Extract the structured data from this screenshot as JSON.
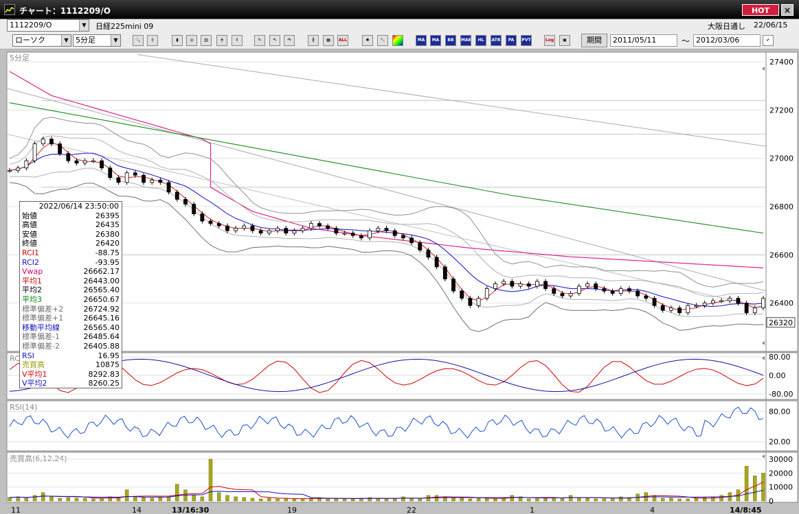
{
  "window": {
    "title": "チャート：1112209/O",
    "hot_label": "HOT",
    "close_label": "×"
  },
  "symbol": {
    "code": "1112209/O",
    "name": "日経225mini 09",
    "exchange": "大阪日通し",
    "date": "22/06/15"
  },
  "toolbar": {
    "chart_type": "ローソク",
    "interval": "5分足",
    "icons": [
      "zoom-icon",
      "crosshair-icon",
      "candle-icon",
      "search-chart-icon",
      "bar-chart-icon",
      "compare-icon",
      "info-icon",
      "pencil-icon",
      "cursor-icon",
      "redo-icon",
      "candle-compare-icon",
      "grid-icon",
      "all-label",
      "settings-icon",
      "paint-icon",
      "palette-icon",
      "ma-icon",
      "bb-icon",
      "mae-icon",
      "hl-icon",
      "atr-icon",
      "para-icon",
      "pvt-icon",
      "log-icon",
      "export-icon"
    ],
    "all_label": "ALL",
    "ma_label": "MA",
    "bb_label": "BB",
    "mae_label": "MAE",
    "hl_label": "HL",
    "atr_label": "ATR",
    "para_label": "PA RA",
    "pvt_label": "PVT",
    "log_label": "Log",
    "period_label": "期間",
    "date_from": "2011/05/11",
    "date_to": "2012/03/06",
    "tilde": "〜"
  },
  "panels": {
    "main_label": "5分足",
    "rci_label": "RC",
    "rsi_label": "RSI(14)",
    "volume_label": "売買高(6,12,24)",
    "current_price": "26320"
  },
  "price_axis": [
    "27400",
    "27200",
    "27000",
    "26800",
    "26600",
    "26400"
  ],
  "rci_axis": [
    "80.00",
    "0.00",
    "-80.00"
  ],
  "rsi_axis": [
    "80.00",
    "20.00"
  ],
  "volume_axis": [
    "30000",
    "20000",
    "10000",
    "0"
  ],
  "time_axis": [
    "11",
    "14",
    "13/16:30",
    "19",
    "22",
    "1",
    "4",
    "14/8:45"
  ],
  "info": {
    "datetime": "2022/06/14 23:50:00",
    "rows": [
      {
        "label": "始値",
        "value": "26395",
        "color": "#000"
      },
      {
        "label": "高値",
        "value": "26435",
        "color": "#000"
      },
      {
        "label": "安値",
        "value": "26380",
        "color": "#000"
      },
      {
        "label": "終値",
        "value": "26420",
        "color": "#000"
      },
      {
        "label": "RCI1",
        "value": "-88.75",
        "color": "#d00000"
      },
      {
        "label": "RCI2",
        "value": "-93.95",
        "color": "#1010c0"
      },
      {
        "label": "Vwap",
        "value": "26662.17",
        "color": "#d0006a"
      },
      {
        "label": "平均1",
        "value": "26443.00",
        "color": "#d00000"
      },
      {
        "label": "平均2",
        "value": "26565.40",
        "color": "#000"
      },
      {
        "label": "平均3",
        "value": "26650.67",
        "color": "#008000"
      },
      {
        "label": "標準偏差+2",
        "value": "26724.92",
        "color": "#707070"
      },
      {
        "label": "標準偏差+1",
        "value": "26645.16",
        "color": "#707070"
      },
      {
        "label": "移動平均線",
        "value": "26565.40",
        "color": "#1010c0"
      },
      {
        "label": "標準偏差-1",
        "value": "26485.64",
        "color": "#707070"
      },
      {
        "label": "標準偏差-2",
        "value": "26405.88",
        "color": "#707070"
      },
      {
        "label": "RSI",
        "value": "16.95",
        "color": "#1010c0"
      },
      {
        "label": "売買高",
        "value": "10875",
        "color": "#9a9a00"
      },
      {
        "label": "V平均1",
        "value": "8292.83",
        "color": "#d00000"
      },
      {
        "label": "V平均2",
        "value": "8260.25",
        "color": "#1010c0"
      }
    ]
  },
  "chart_data": {
    "type": "line",
    "close_path": [
      26950,
      26960,
      26990,
      27060,
      27080,
      27060,
      27020,
      26990,
      26980,
      26990,
      26990,
      26960,
      26920,
      26900,
      26940,
      26930,
      26900,
      26910,
      26900,
      26860,
      26830,
      26810,
      26770,
      26740,
      26730,
      26720,
      26700,
      26710,
      26720,
      26700,
      26690,
      26700,
      26710,
      26690,
      26700,
      26710,
      26730,
      26720,
      26710,
      26690,
      26690,
      26680,
      26670,
      26700,
      26710,
      26700,
      26680,
      26670,
      26650,
      26620,
      26590,
      26550,
      26500,
      26450,
      26420,
      26390,
      26420,
      26460,
      26480,
      26490,
      26470,
      26480,
      26470,
      26490,
      26460,
      26440,
      26430,
      26440,
      26470,
      26480,
      26460,
      26450,
      26440,
      26460,
      26450,
      26430,
      26420,
      26390,
      26370,
      26380,
      26360,
      26390,
      26390,
      26400,
      26410,
      26410,
      26420,
      26400,
      26360,
      26380,
      26420
    ],
    "volume": [
      2500,
      3000,
      2000,
      4000,
      6000,
      3000,
      2000,
      2500,
      2000,
      2000,
      1500,
      2000,
      3000,
      2500,
      8000,
      3000,
      2500,
      2000,
      2500,
      3000,
      12000,
      8000,
      4000,
      3000,
      30000,
      6000,
      4000,
      3000,
      2500,
      2000,
      1500,
      2000,
      1500,
      2000,
      1500,
      1500,
      2000,
      2500,
      1500,
      2000,
      1500,
      1500,
      2000,
      2500,
      2000,
      1500,
      1500,
      3000,
      2000,
      2000,
      4000,
      4000,
      3000,
      2000,
      2000,
      1500,
      2000,
      2000,
      1500,
      2500,
      4000,
      3000,
      1500,
      2000,
      2000,
      2500,
      2000,
      4000,
      2000,
      2000,
      1500,
      1500,
      2000,
      3000,
      2500,
      5000,
      6000,
      4000,
      2000,
      2000,
      1500,
      1500,
      2000,
      2500,
      3000,
      4000,
      6000,
      8000,
      25000,
      18000,
      20000
    ]
  }
}
